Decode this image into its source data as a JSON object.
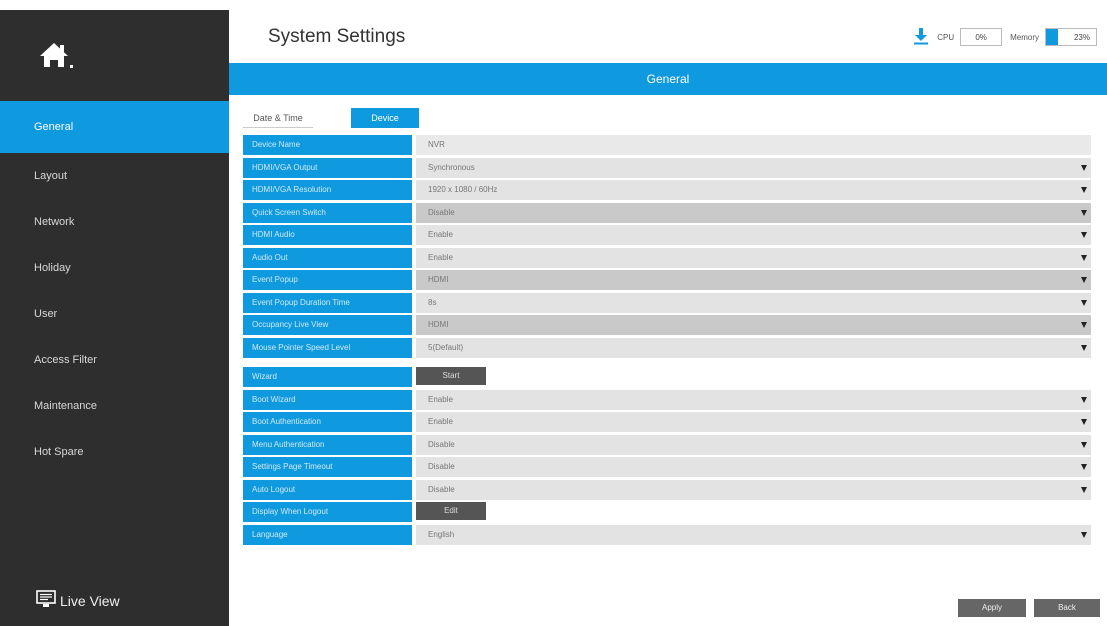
{
  "header": {
    "title": "System Settings",
    "cpu_label": "CPU",
    "cpu_value": "0%",
    "memory_label": "Memory",
    "memory_value": "23%",
    "memory_fraction": 0.23,
    "download_icon": "download-icon",
    "accent": "#0f9ae0"
  },
  "sidebar": {
    "logo_icon": "home-icon",
    "items": [
      {
        "label": "General",
        "active": true
      },
      {
        "label": "Layout"
      },
      {
        "label": "Network"
      },
      {
        "label": "Holiday"
      },
      {
        "label": "User"
      },
      {
        "label": "Access Filter"
      },
      {
        "label": "Maintenance"
      },
      {
        "label": "Hot Spare"
      }
    ],
    "live_view_label": "Live View",
    "live_view_icon": "monitor-icon"
  },
  "section": {
    "title": "General"
  },
  "tabs": [
    {
      "label": "Date & Time"
    },
    {
      "label": "Device"
    }
  ],
  "form": {
    "rows": [
      {
        "label": "Device Name",
        "value": "NVR"
      },
      {
        "label": "HDMI/VGA Output",
        "value": "Synchronous"
      },
      {
        "label": "HDMI/VGA Resolution",
        "value": "1920 x 1080 / 60Hz"
      },
      {
        "label": "Quick Screen Switch",
        "value": "Disable"
      },
      {
        "label": "HDMI Audio",
        "value": "Enable"
      },
      {
        "label": "Audio Out",
        "value": "Enable"
      },
      {
        "label": "Event Popup",
        "value": "HDMI"
      },
      {
        "label": "Event Popup Duration Time",
        "value": "8s"
      },
      {
        "label": "Occupancy Live View",
        "value": "HDMI"
      },
      {
        "label": "Mouse Pointer Speed Level",
        "value": "5(Default)"
      },
      {
        "label": "Wizard",
        "value": "Start"
      },
      {
        "label": "Boot Wizard",
        "value": "Enable"
      },
      {
        "label": "Boot Authentication",
        "value": "Enable"
      },
      {
        "label": "Menu Authentication",
        "value": "Disable"
      },
      {
        "label": "Settings Page Timeout",
        "value": "Disable"
      },
      {
        "label": "Auto Logout",
        "value": "Disable"
      },
      {
        "label": "Display When Logout",
        "value": "Edit"
      },
      {
        "label": "Language",
        "value": "English"
      }
    ]
  },
  "footer": {
    "apply_label": "Apply",
    "back_label": "Back"
  }
}
